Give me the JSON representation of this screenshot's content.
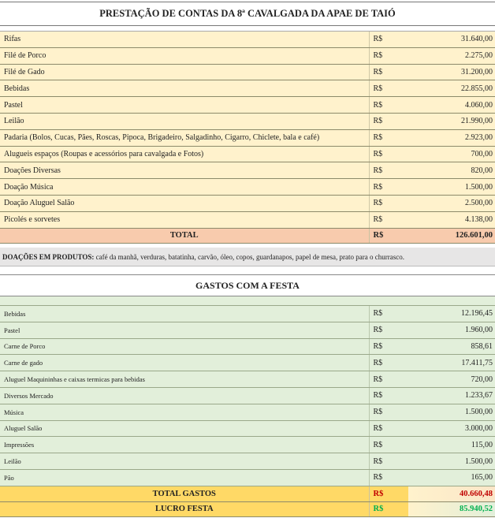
{
  "title": "PRESTAÇÃO DE CONTAS DA 8ª CAVALGADA DA APAE DE TAIÓ",
  "currency": "R$",
  "income": [
    {
      "label": "Rifas",
      "value": "31.640,00"
    },
    {
      "label": "Filé de Porco",
      "value": "2.275,00"
    },
    {
      "label": "Filé de Gado",
      "value": "31.200,00"
    },
    {
      "label": "Bebidas",
      "value": "22.855,00"
    },
    {
      "label": "Pastel",
      "value": "4.060,00"
    },
    {
      "label": "Leilão",
      "value": "21.990,00"
    },
    {
      "label": "Padaria (Bolos, Cucas, Pães, Roscas, Pipoca, Brigadeiro, Salgadinho, Cigarro, Chiclete, bala e café)",
      "value": "2.923,00"
    },
    {
      "label": "Alugueis espaços (Roupas e acessórios para cavalgada e Fotos)",
      "value": "700,00"
    },
    {
      "label": "Doações Diversas",
      "value": "820,00"
    },
    {
      "label": "Doação Música",
      "value": "1.500,00"
    },
    {
      "label": "Doação Aluguel Salão",
      "value": "2.500,00"
    },
    {
      "label": "Picolés e sorvetes",
      "value": "4.138,00"
    }
  ],
  "income_total": {
    "label": "TOTAL",
    "value": "126.601,00"
  },
  "donations": {
    "heading": "DOAÇÕES EM PRODUTOS:",
    "text": " café da manhã, verduras, batatinha, carvão, óleo, copos, guardanapos, papel de mesa, prato para o churrasco."
  },
  "expenses_title": "GASTOS COM A FESTA",
  "expenses": [
    {
      "label": "Bebidas",
      "value": "12.196,45"
    },
    {
      "label": "Pastel",
      "value": "1.960,00"
    },
    {
      "label": "Carne de Porco",
      "value": "858,61"
    },
    {
      "label": "Carne de gado",
      "value": "17.411,75"
    },
    {
      "label": "Aluguel Maquininhas e caixas termicas para bebidas",
      "value": "720,00"
    },
    {
      "label": "Diversos Mercado",
      "value": "1.233,67"
    },
    {
      "label": "Música",
      "value": "1.500,00"
    },
    {
      "label": "Aluguel Salão",
      "value": "3.000,00"
    },
    {
      "label": "Impressões",
      "value": "115,00"
    },
    {
      "label": "Leilão",
      "value": "1.500,00"
    },
    {
      "label": "Pão",
      "value": "165,00"
    }
  ],
  "expenses_total": {
    "label": "TOTAL GASTOS",
    "value": "40.660,48"
  },
  "profit": {
    "label": "LUCRO FESTA",
    "value": "85.940,52"
  },
  "colors": {
    "income_bg": "#fff2cc",
    "total_bg": "#f8cbad",
    "expenses_bg": "#e2efda",
    "summary_bg": "#ffd966",
    "negative": "#c00000",
    "positive": "#00b050"
  }
}
